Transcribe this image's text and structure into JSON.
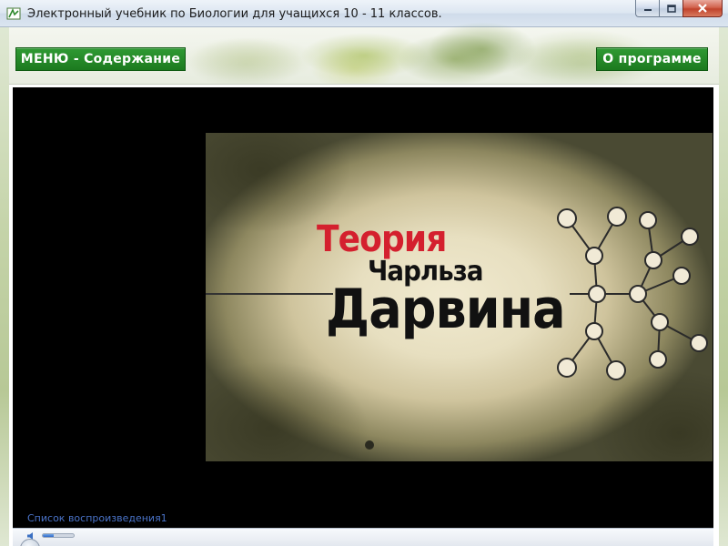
{
  "window": {
    "title": "Электронный учебник по Биологии для учащихся 10 - 11 классов.",
    "icon": "leaf-app-icon",
    "controls": [
      "minimize-icon",
      "maximize-icon",
      "close-icon"
    ]
  },
  "header": {
    "menu_button": "МЕНЮ - Содержание",
    "about_button": "О программе"
  },
  "video": {
    "title_line1": "Теория",
    "title_line2": "Чарльза",
    "title_line3": "Дарвина",
    "title_red": "#d4202e"
  },
  "player": {
    "playlist_label": "Список воспроизведения1",
    "volume_level": 0.35
  },
  "colors": {
    "accent_green": "#1c7a1f",
    "link_blue": "#4a73c8"
  }
}
